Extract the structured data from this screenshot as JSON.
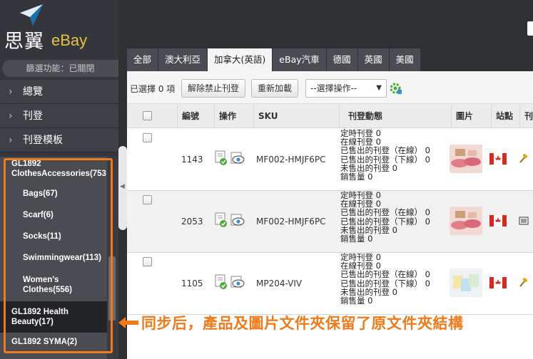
{
  "app": {
    "logo_text": "思翼",
    "logo_brand": "eBay"
  },
  "sidebar": {
    "filter_label": "篩選功能：已關閉",
    "menu": [
      {
        "label": "總覽"
      },
      {
        "label": "刊登"
      },
      {
        "label": "刊登模板"
      }
    ],
    "tree": [
      {
        "label": "GL1892 ClothesAccessories(753"
      },
      {
        "label": "Bags(67)"
      },
      {
        "label": "Scarf(6)"
      },
      {
        "label": "Socks(11)"
      },
      {
        "label": "Swimmingwear(113)"
      },
      {
        "label": "Women's Clothes(556)"
      },
      {
        "label": "GL1892 Health Beauty(17)"
      },
      {
        "label": "GL1892 SYMA(2)"
      }
    ]
  },
  "tabs": [
    {
      "label": "全部"
    },
    {
      "label": "澳大利亞"
    },
    {
      "label": "加拿大(英語)"
    },
    {
      "label": "eBay汽車"
    },
    {
      "label": "德國"
    },
    {
      "label": "英國"
    },
    {
      "label": "美國"
    }
  ],
  "toolbar": {
    "selected_count": "已選擇 0 項",
    "unban_label": "解除禁止刊登",
    "reload_label": "重新加載",
    "action_select": "--選擇操作--"
  },
  "table": {
    "headers": {
      "id": "編號",
      "ops": "操作",
      "sku": "SKU",
      "status": "刊登動態",
      "image": "圖片",
      "site": "站點",
      "more": "刊"
    },
    "status_labels": [
      "定時刊登",
      "在線刊登",
      "已售出的刊登（在線）",
      "已售出的刊登（下線）",
      "未售出的刊登",
      "銷售量"
    ],
    "rows": [
      {
        "id": "1143",
        "sku": "MF002-HMJF6PC",
        "counts": [
          "0",
          "0",
          "0",
          "0",
          "0",
          "0"
        ]
      },
      {
        "id": "2053",
        "sku": "MF002-HMJF6PC",
        "counts": [
          "0",
          "0",
          "0",
          "0",
          "0",
          "0"
        ]
      },
      {
        "id": "1105",
        "sku": "MP204-VIV",
        "counts": [
          "0",
          "0",
          "0",
          "0",
          "0",
          "0"
        ]
      }
    ]
  },
  "annotation": {
    "text": "同步后，產品及圖片文件夾保留了原文件夾結構"
  },
  "colors": {
    "accent": "#f07a1a",
    "sidebar": "#34363b",
    "canada_red": "#d52b1e"
  }
}
